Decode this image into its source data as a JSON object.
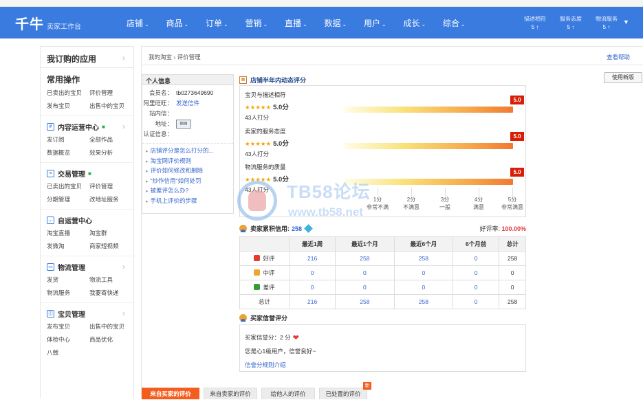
{
  "header": {
    "logo": "千牛",
    "logo_sub": "卖家工作台",
    "nav": [
      {
        "label": "店铺"
      },
      {
        "label": "商品"
      },
      {
        "label": "订单"
      },
      {
        "label": "营销"
      },
      {
        "label": "直播"
      },
      {
        "label": "数据"
      },
      {
        "label": "用户"
      },
      {
        "label": "成长"
      },
      {
        "label": "综合"
      }
    ],
    "metrics": [
      {
        "label": "描述相符",
        "value": "5 ↑"
      },
      {
        "label": "服务态度",
        "value": "5 ↑"
      },
      {
        "label": "物流服务",
        "value": "5 ↑"
      }
    ]
  },
  "sidebar": {
    "top_label": "我订购的应用",
    "sections": [
      {
        "title": "常用操作",
        "icon": "",
        "links": [
          "已卖出的宝贝",
          "评价管理",
          "发布宝贝",
          "出售中的宝贝"
        ]
      },
      {
        "title": "内容运营中心",
        "icon": "hashtag-icon",
        "links": [
          "发订阅",
          "全部作品",
          "数据概览",
          "效果分析"
        ]
      },
      {
        "title": "交易管理",
        "icon": "trade-icon",
        "links": [
          "已卖出的宝贝",
          "评价管理",
          "分期管理",
          "改地址服务"
        ]
      },
      {
        "title": "自运营中心",
        "icon": "chat-icon",
        "links": [
          "淘宝直播",
          "淘宝群",
          "发微淘",
          "商家短视频"
        ]
      },
      {
        "title": "物流管理",
        "icon": "logistics-icon",
        "links": [
          "发货",
          "物流工具",
          "物流服务",
          "我要寄快递"
        ]
      },
      {
        "title": "宝贝管理",
        "icon": "goods-icon",
        "links": [
          "发布宝贝",
          "出售中的宝贝",
          "体检中心",
          "商品优化",
          "八戟"
        ]
      }
    ]
  },
  "breadcrumb": {
    "home": "我的淘宝",
    "sep": "›",
    "current": "评价管理"
  },
  "help_label": "查看帮助",
  "new_version_label": "使用新版",
  "info": {
    "title": "个人信息",
    "rows": [
      {
        "label": "会员名：",
        "value": "tb0273649690",
        "link": false
      },
      {
        "label": "阿里旺旺：",
        "value": "发送信件",
        "link": true
      },
      {
        "label": "站内信：",
        "value": "",
        "link": false
      },
      {
        "label": "地址：",
        "value": "",
        "link": false
      },
      {
        "label": "认证信息：",
        "value": "",
        "link": false
      }
    ],
    "links": [
      "店铺评分是怎么打分的...",
      "淘宝网评价规则",
      "评价如何修改和删除",
      "\"炒作信用\"如何处罚",
      "被差评怎么办?",
      "手机上评价的步骤"
    ]
  },
  "dsr": {
    "title": "店铺半年内动态评分",
    "items": [
      {
        "label": "宝贝与描述相符",
        "score": "5.0分",
        "count": "43人打分",
        "badge": "5.0",
        "level": 1.0
      },
      {
        "label": "卖家的服务态度",
        "score": "5.0分",
        "count": "43人打分",
        "badge": "5.0",
        "level": 1.0
      },
      {
        "label": "物流服务的质量",
        "score": "5.0分",
        "count": "43人打分",
        "badge": "5.0",
        "level": 1.0
      }
    ],
    "stars": "★★★★★",
    "scale": [
      {
        "score": "1分",
        "desc": "非常不满"
      },
      {
        "score": "2分",
        "desc": "不满意"
      },
      {
        "score": "3分",
        "desc": "一般"
      },
      {
        "score": "4分",
        "desc": "满意"
      },
      {
        "score": "5分",
        "desc": "非常满意"
      }
    ]
  },
  "credit": {
    "title": "卖家累积信用:",
    "value": "258",
    "good_rate_label": "好评率:",
    "good_rate": "100.00%",
    "columns": [
      "",
      "最近1周",
      "最近1个月",
      "最近6个月",
      "6个月前",
      "总计"
    ],
    "rows": [
      {
        "label": "好评",
        "icon": "good-icon",
        "values": [
          "216",
          "258",
          "258",
          "0",
          "258"
        ]
      },
      {
        "label": "中评",
        "icon": "neutral-icon",
        "values": [
          "0",
          "0",
          "0",
          "0",
          "0"
        ]
      },
      {
        "label": "差评",
        "icon": "bad-icon",
        "values": [
          "0",
          "0",
          "0",
          "0",
          "0"
        ]
      },
      {
        "label": "总计",
        "icon": "",
        "values": [
          "216",
          "258",
          "258",
          "0",
          "258"
        ]
      }
    ]
  },
  "buyer": {
    "title": "买家信誉评分",
    "score_line": "买家信誉分：2 分",
    "desc": "您是心1级用户，信誉良好~",
    "link": "信誉分规则介绍"
  },
  "tabs": [
    {
      "label": "来自买家的评价",
      "active": true
    },
    {
      "label": "来自卖家的评价",
      "active": false
    },
    {
      "label": "给他人的评价",
      "active": false
    },
    {
      "label": "已处置的评价",
      "active": false
    }
  ],
  "new_badge": "新",
  "watermark": {
    "text": "TB58论坛",
    "url": "www.tb58.net"
  },
  "colors": {
    "brand_blue": "#3a7be0",
    "accent_orange": "#f55d1e",
    "badge_red": "#d81e06"
  }
}
